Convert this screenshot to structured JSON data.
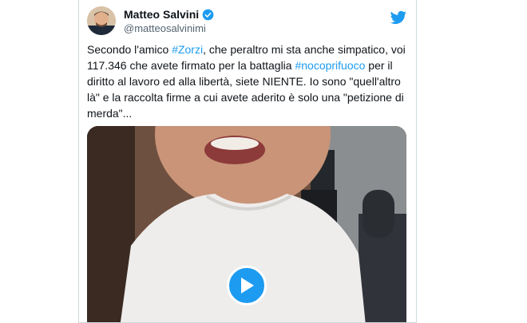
{
  "tweet": {
    "author_name": "Matteo Salvini",
    "author_handle": "@matteosalvinimi",
    "text_segments": {
      "p1": "Secondo l'amico ",
      "tag1": "#Zorzi",
      "p2": ", che peraltro mi sta anche simpatico, voi 117.346 che avete firmato per la battaglia ",
      "tag2": "#nocoprifuoco",
      "p3": " per il diritto al lavoro ed alla libertà, siete NIENTE. Io sono \"quell'altro là\" e la raccolta firme a cui avete aderito è solo una \"petizione di merda\"..."
    }
  },
  "colors": {
    "link": "#1d9bf0",
    "twitter_blue": "#1d9bf0",
    "text": "#0f1419",
    "muted": "#536471"
  },
  "icons": {
    "verified": "verified-badge-icon",
    "brand": "twitter-bird-icon",
    "play": "play-icon"
  }
}
